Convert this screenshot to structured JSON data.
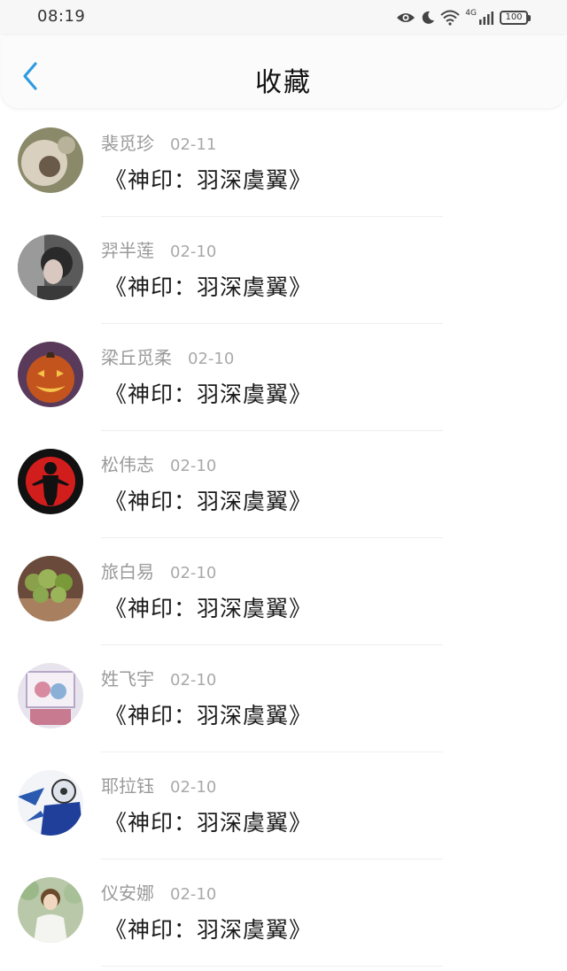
{
  "status_bar": {
    "time": "08:19",
    "network": "4G",
    "battery": "100"
  },
  "header": {
    "title": "收藏",
    "back_icon": "chevron-left-icon",
    "accent_color": "#2f9be0"
  },
  "favorites": [
    {
      "user": "裴觅珍",
      "date": "02-11",
      "title": "《神印：羽深虞翼》",
      "avatar_theme": "beige-close-up"
    },
    {
      "user": "羿半莲",
      "date": "02-10",
      "title": "《神印：羽深虞翼》",
      "avatar_theme": "portrait-dark"
    },
    {
      "user": "梁丘觅柔",
      "date": "02-10",
      "title": "《神印：羽深虞翼》",
      "avatar_theme": "pumpkin"
    },
    {
      "user": "松伟志",
      "date": "02-10",
      "title": "《神印：羽深虞翼》",
      "avatar_theme": "red-silhouette"
    },
    {
      "user": "旅白易",
      "date": "02-10",
      "title": "《神印：羽深虞翼》",
      "avatar_theme": "food"
    },
    {
      "user": "姓飞宇",
      "date": "02-10",
      "title": "《神印：羽深虞翼》",
      "avatar_theme": "anime"
    },
    {
      "user": "耶拉钰",
      "date": "02-10",
      "title": "《神印：羽深虞翼》",
      "avatar_theme": "blue-character"
    },
    {
      "user": "仪安娜",
      "date": "02-10",
      "title": "《神印：羽深虞翼》",
      "avatar_theme": "person-white"
    }
  ]
}
